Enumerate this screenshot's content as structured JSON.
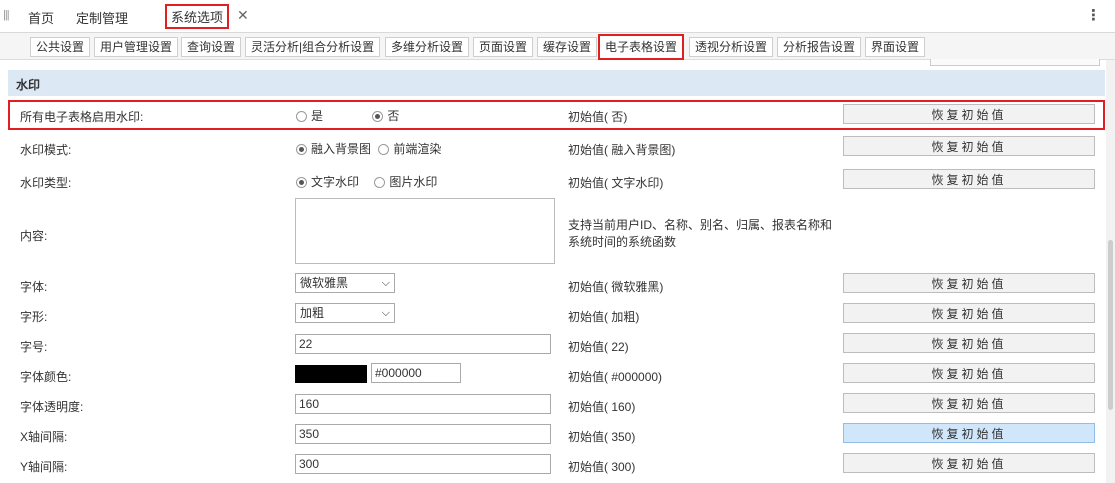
{
  "topbar": {
    "tabs": [
      "首页",
      "定制管理",
      "系统选项"
    ],
    "close_glyph": "✕",
    "more_glyph": "⋮",
    "grip_glyph": "|||"
  },
  "subtabs": [
    "公共设置",
    "用户管理设置",
    "查询设置",
    "灵活分析|组合分析设置",
    "多维分析设置",
    "页面设置",
    "缓存设置",
    "电子表格设置",
    "透视分析设置",
    "分析报告设置",
    "界面设置"
  ],
  "section": {
    "title": "水印"
  },
  "rows": {
    "enable": {
      "label": "所有电子表格启用水印:",
      "opt1": "是",
      "opt2": "否",
      "initial": "初始值( 否)"
    },
    "mode": {
      "label": "水印模式:",
      "opt1": "融入背景图",
      "opt2": "前端渲染",
      "initial": "初始值( 融入背景图)"
    },
    "type": {
      "label": "水印类型:",
      "opt1": "文字水印",
      "opt2": "图片水印",
      "initial": "初始值( 文字水印)"
    },
    "content": {
      "label": "内容:",
      "desc": "支持当前用户ID、名称、别名、归属、报表名称和系统时间的系统函数"
    },
    "font": {
      "label": "字体:",
      "value": "微软雅黑",
      "initial": "初始值( 微软雅黑)"
    },
    "style": {
      "label": "字形:",
      "value": "加粗",
      "initial": "初始值( 加粗)"
    },
    "size": {
      "label": "字号:",
      "value": "22",
      "initial": "初始值( 22)"
    },
    "color": {
      "label": "字体颜色:",
      "value": "#000000",
      "initial": "初始值( #000000)",
      "swatch": "#000000"
    },
    "opacity": {
      "label": "字体透明度:",
      "value": "160",
      "initial": "初始值( 160)"
    },
    "xgap": {
      "label": "X轴间隔:",
      "value": "350",
      "initial": "初始值( 350)"
    },
    "ygap": {
      "label": "Y轴间隔:",
      "value": "300",
      "initial": "初始值( 300)"
    }
  },
  "reset_label": "恢复初始值",
  "chevron_glyph": "⌵",
  "colors": {
    "accent_red": "#e02020",
    "section_bg": "#dde8f5",
    "button_hover": "#cfe6fb"
  }
}
